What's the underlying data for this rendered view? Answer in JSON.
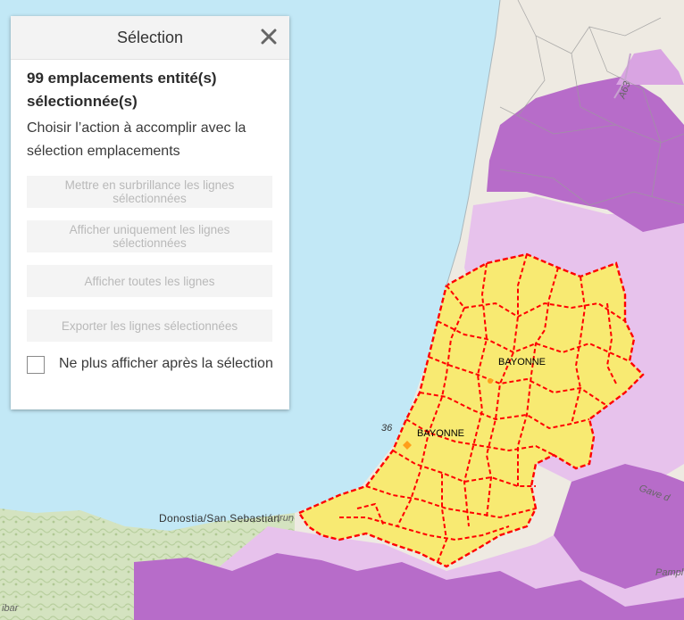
{
  "panel": {
    "title": "Sélection",
    "count_text": "99 emplacements entité(s) sélectionnée(s)",
    "instruction": "Choisir l’action à accomplir avec la sélection emplacements",
    "actions": [
      {
        "label": "Mettre en surbrillance les lignes sélectionnées",
        "enabled": false
      },
      {
        "label": "Afficher uniquement les lignes sélectionnées",
        "enabled": false
      },
      {
        "label": "Afficher toutes les lignes",
        "enabled": false
      },
      {
        "label": "Exporter les lignes sélectionnées",
        "enabled": false
      }
    ],
    "checkbox": {
      "label": "Ne plus afficher après la sélection",
      "checked": false
    },
    "close_icon": "close-icon"
  },
  "map": {
    "labels": {
      "bayonne_1": "BAYONNE",
      "bayonne_2": "BAYONNE",
      "donostia": "Donostia/San Sebastián",
      "irun": "Irun",
      "road_36": "36",
      "road_a63": "A63",
      "gave": "Gave d",
      "pamplona": "Pampl",
      "bilbao": "ibar"
    },
    "colors": {
      "sea": "#c2e8f6",
      "land": "#eeeae2",
      "selection_fill": "#f8ea72",
      "selection_outline": "#ff0000",
      "purple_light": "#e7c2ec",
      "purple_dark": "#b76cc9",
      "terrain_green": "#c9dcb4"
    }
  }
}
